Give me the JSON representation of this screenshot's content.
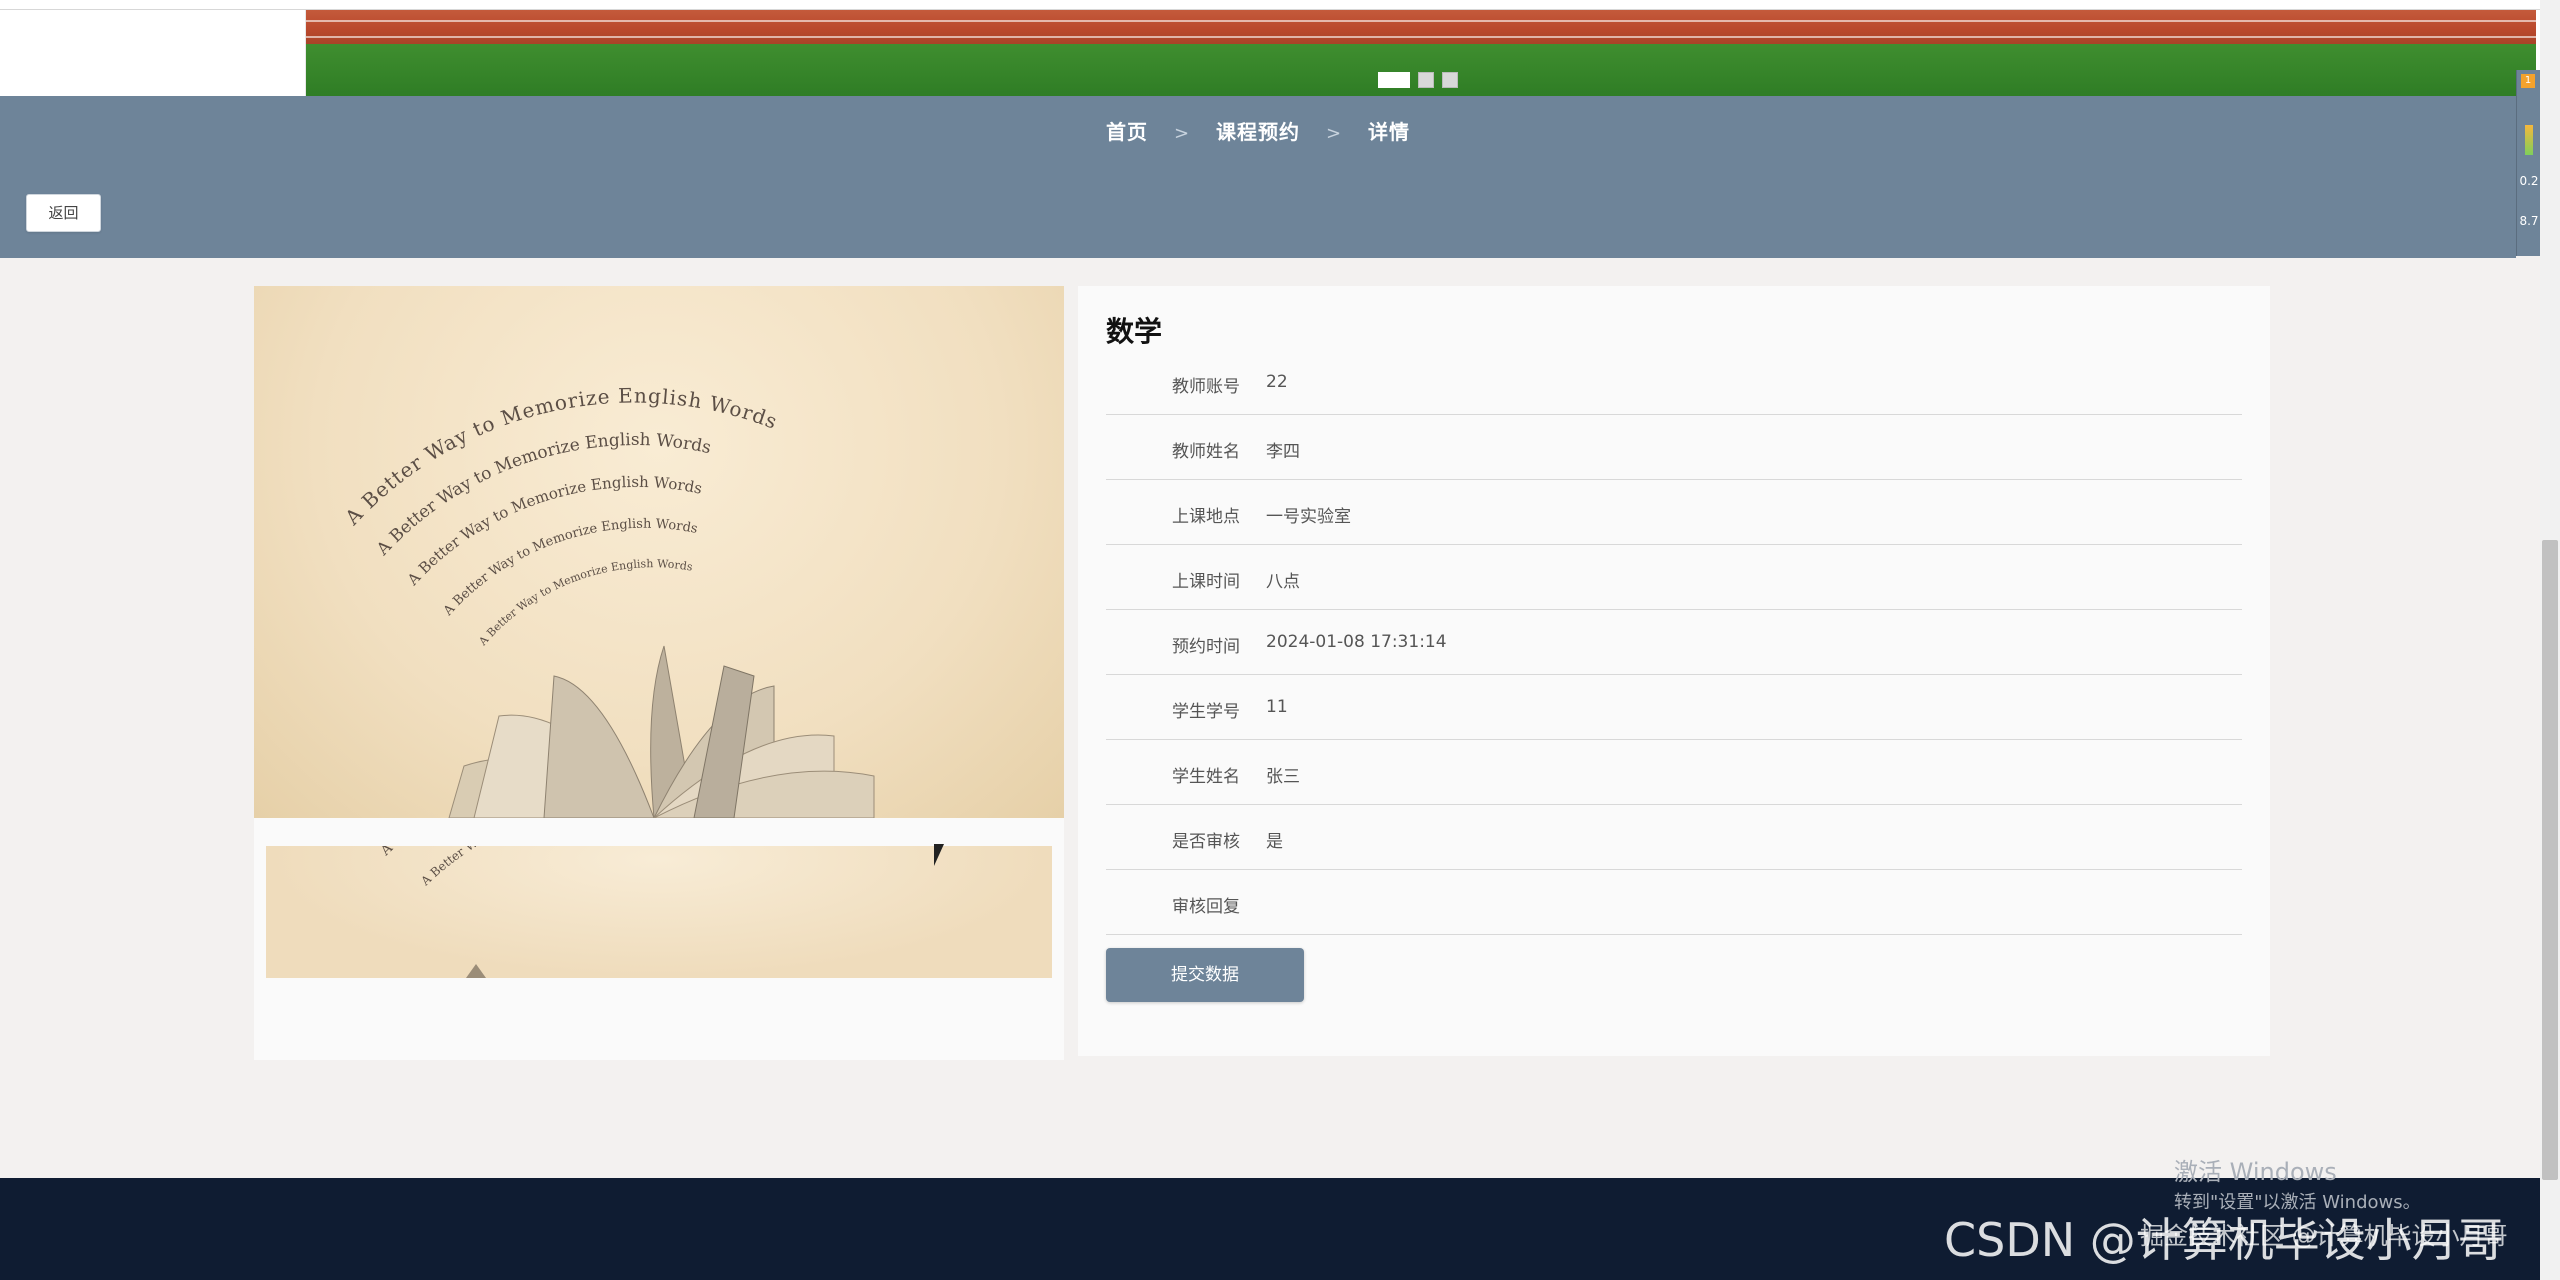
{
  "breadcrumb": {
    "home": "首页",
    "sep1": ">",
    "section": "课程预约",
    "sep2": ">",
    "current": "详情"
  },
  "back_button": "返回",
  "banner": {
    "dots_count": 3,
    "active_dot": 0
  },
  "right_widget": {
    "badge": "1",
    "val1": "0.2",
    "val2": "8.7"
  },
  "image_text": {
    "line": "A Better Way to Memorize English Words"
  },
  "detail": {
    "title": "数学",
    "fields": [
      {
        "label": "教师账号",
        "value": "22"
      },
      {
        "label": "教师姓名",
        "value": "李四"
      },
      {
        "label": "上课地点",
        "value": "一号实验室"
      },
      {
        "label": "上课时间",
        "value": "八点"
      },
      {
        "label": "预约时间",
        "value": "2024-01-08 17:31:14"
      },
      {
        "label": "学生学号",
        "value": "11"
      },
      {
        "label": "学生姓名",
        "value": "张三"
      },
      {
        "label": "是否审核",
        "value": "是"
      },
      {
        "label": "审核回复",
        "value": ""
      }
    ],
    "submit_label": "提交数据"
  },
  "os_overlay": {
    "activate_title": "激活 Windows",
    "activate_sub": "转到\"设置\"以激活 Windows。",
    "watermark": "CSDN @计算机毕设小月哥",
    "watermark_small": "掘金技术社区 @计算机毕设小月哥"
  },
  "colors": {
    "accent": "#6e8499",
    "footer": "#0f1c32",
    "page_bg": "#f3f1f0"
  }
}
